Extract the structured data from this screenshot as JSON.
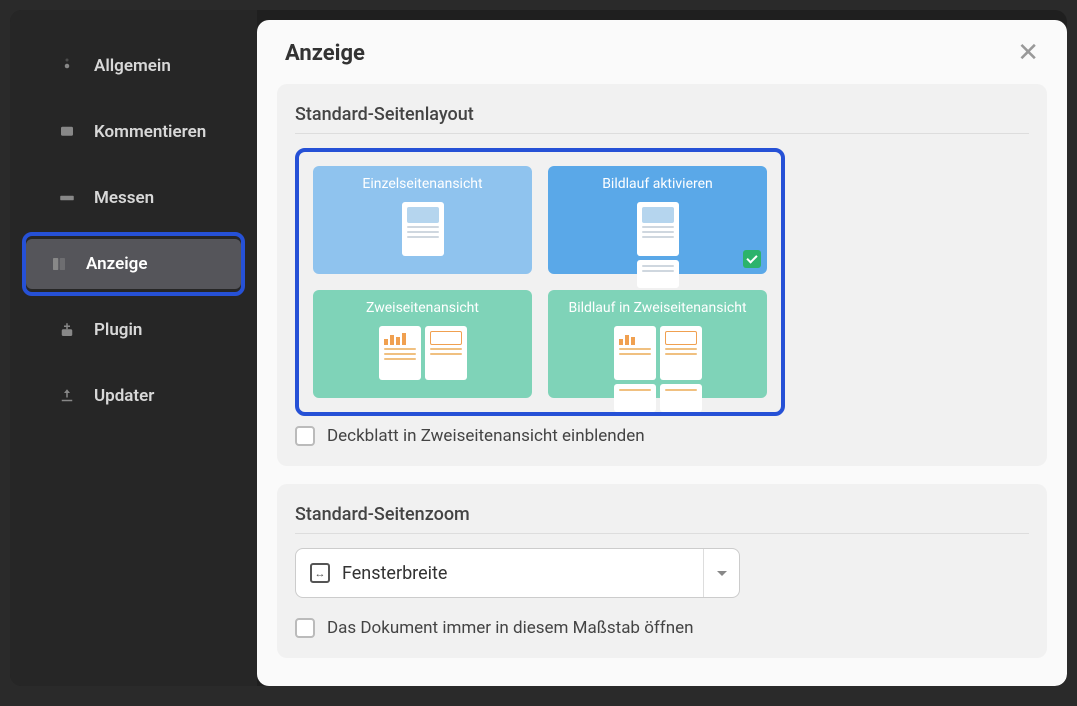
{
  "sidebar": {
    "items": [
      {
        "label": "Allgemein",
        "icon": "gear-icon"
      },
      {
        "label": "Kommentieren",
        "icon": "comment-icon"
      },
      {
        "label": "Messen",
        "icon": "measure-icon"
      },
      {
        "label": "Anzeige",
        "icon": "display-icon"
      },
      {
        "label": "Plugin",
        "icon": "plugin-icon"
      },
      {
        "label": "Updater",
        "icon": "updater-icon"
      }
    ]
  },
  "panel": {
    "title": "Anzeige"
  },
  "layout_section": {
    "title": "Standard-Seitenlayout",
    "options": [
      {
        "label": "Einzelseitenansicht"
      },
      {
        "label": "Bildlauf aktivieren"
      },
      {
        "label": "Zweiseitenansicht"
      },
      {
        "label": "Bildlauf in Zweiseitenansicht"
      }
    ],
    "cover_checkbox": "Deckblatt in Zweiseitenansicht einblenden"
  },
  "zoom_section": {
    "title": "Standard-Seitenzoom",
    "selected": "Fensterbreite",
    "always_open_checkbox": "Das Dokument immer in diesem Maßstab öffnen"
  }
}
